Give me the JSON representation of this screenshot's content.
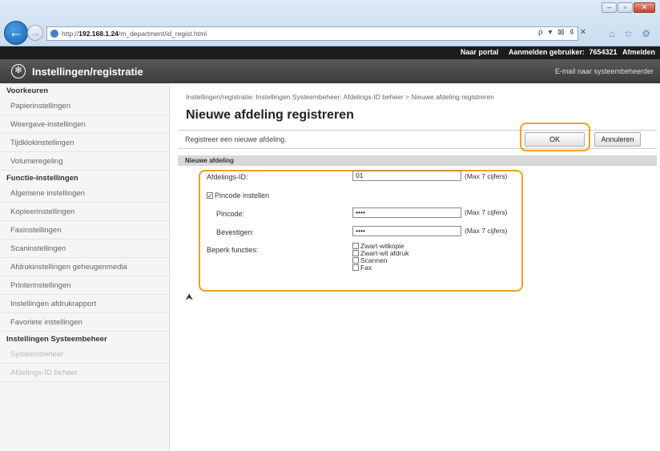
{
  "browser": {
    "url_prefix": "http://",
    "url_host": "192.168.1.24",
    "url_path": "/m_department/id_regist.html",
    "address_tools": "ρ ▾ ⊠ ¢ ✕",
    "icons": "⌂ ☆ ⚙"
  },
  "topbar": {
    "model": "",
    "portal": "Naar portal",
    "login_label": "Aanmelden gebruiker:",
    "login_user": "7654321",
    "logout": "Afmelden"
  },
  "header": {
    "title": "Instellingen/registratie",
    "email": "E-mail naar systeembeheerder"
  },
  "sidebar": {
    "sections": [
      {
        "heading": "Voorkeuren",
        "items": [
          "Papierinstellingen",
          "Weergave-instellingen",
          "Tijdklokinstellingen",
          "Volumeregeling"
        ]
      },
      {
        "heading": "Functie-instellingen",
        "items": [
          "Algemene instellingen",
          "Kopieerinstellingen",
          "Faxinstellingen",
          "Scaninstellingen",
          "Afdrukinstellingen geheugenmedia",
          "Printerinstellingen",
          "Instellingen afdrukrapport",
          "Favoriete instellingen"
        ]
      },
      {
        "heading": "Instellingen Systeembeheer",
        "items": [
          "Systeembeheer",
          "Afdelings-ID beheer"
        ]
      }
    ]
  },
  "main": {
    "breadcrumb": "Instellingen/registratie: Instellingen Systeembeheer: Afdelings-ID beheer > Nieuwe afdeling registreren",
    "title": "Nieuwe afdeling registreren",
    "description": "Registreer een nieuwe afdeling.",
    "ok_label": "OK",
    "cancel_label": "Annuleren",
    "section_title": "Nieuwe afdeling",
    "dept_id_label": "Afdelings-ID:",
    "dept_id_value": "01",
    "max_hint": "(Max 7 cijfers)",
    "pin_checkbox_label": "Pincode instellen",
    "pin_label": "Pincode:",
    "pin_value": "••••",
    "confirm_label": "Bevestigen:",
    "confirm_value": "••••",
    "restrict_label": "Beperk functies:",
    "restrict_options": [
      "Zwart-witkopie",
      "Zwart-wit afdruk",
      "Scannen",
      "Fax"
    ],
    "top_icon": "⮝"
  },
  "colors": {
    "highlight": "#f0a020"
  }
}
